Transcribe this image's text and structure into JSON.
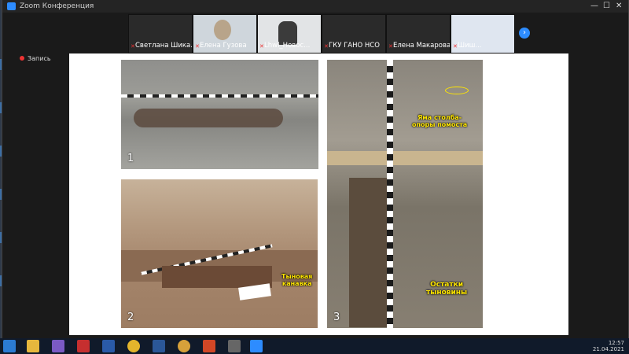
{
  "window": {
    "title": "Zoom Конференция"
  },
  "participants": [
    {
      "name": "Светлана Шика..."
    },
    {
      "name": "Елена Гузова"
    },
    {
      "name": "Lhwl_Новос..."
    },
    {
      "name": "ГКУ ГАНО НСО"
    },
    {
      "name": "Елена Макарова"
    },
    {
      "name": "Шиш..."
    }
  ],
  "recording": {
    "label": "Запись"
  },
  "slide": {
    "photos": [
      {
        "number": "1"
      },
      {
        "number": "2",
        "label": "Тыновая\nканавка"
      },
      {
        "number": "3",
        "label_top": "Яма столба-\nопоры помоста",
        "label_bottom": "Остатки\nтыновины"
      }
    ]
  },
  "taskbar": {
    "apps": [
      "start",
      "explorer",
      "visual-studio",
      "acrobat",
      "photoshop",
      "chrome",
      "word",
      "browser",
      "powerpoint",
      "media-player",
      "zoom"
    ],
    "time": "12:57",
    "date": "21.04.2021"
  }
}
